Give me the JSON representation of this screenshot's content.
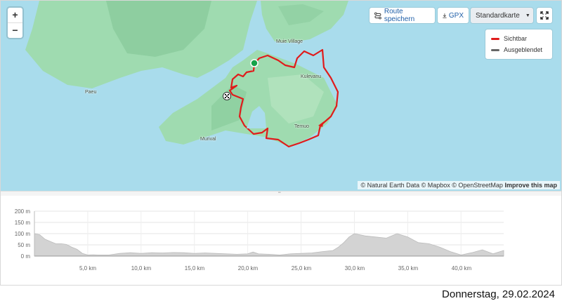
{
  "map": {
    "zoom_in": "+",
    "zoom_out": "−",
    "places": [
      "Muie Village",
      "Kulevanu",
      "Paeu",
      "Temuo",
      "Murival"
    ],
    "colors": {
      "water": "#a9dcec",
      "land": "#9fdbb0",
      "route": "#e01b1b"
    }
  },
  "toolbar": {
    "save_route": "Route speichern",
    "save_icon": "route-icon",
    "gpx": "GPX",
    "gpx_icon": "download-icon",
    "map_style": "Standardkarte",
    "fullscreen_icon": "fullscreen-icon"
  },
  "legend": {
    "items": [
      {
        "label": "Sichtbar",
        "color": "#e01b1b"
      },
      {
        "label": "Ausgeblendet",
        "color": "#666666"
      }
    ]
  },
  "attribution": {
    "text": "© Natural Earth Data © Mapbox © OpenStreetMap",
    "improve": "Improve this map"
  },
  "chart_data": {
    "type": "area",
    "y_ticks": [
      "0 m",
      "50 m",
      "100 m",
      "150 m",
      "200 m"
    ],
    "x_ticks": [
      "5,0 km",
      "10,0 km",
      "15,0 km",
      "20,0 km",
      "25,0 km",
      "30,0 km",
      "35,0 km",
      "40,0 km"
    ],
    "xlim": [
      0,
      44
    ],
    "ylim": [
      0,
      200
    ],
    "grid": true,
    "series": [
      {
        "x": [
          0,
          0.5,
          1,
          1.5,
          2,
          2.5,
          3,
          3.5,
          4,
          4.5,
          5,
          5.5,
          6,
          7,
          8,
          9,
          10,
          11,
          12,
          13,
          14,
          15,
          16,
          17,
          18,
          19,
          20,
          20.5,
          21,
          22,
          23,
          24,
          25,
          26,
          27,
          28,
          28.5,
          29,
          29.5,
          30,
          31,
          32,
          33,
          34,
          35,
          36,
          37,
          38,
          39,
          40,
          41,
          42,
          43,
          44
        ],
        "y": [
          100,
          95,
          75,
          65,
          55,
          55,
          52,
          40,
          30,
          12,
          5,
          6,
          5,
          5,
          12,
          15,
          12,
          15,
          14,
          16,
          15,
          12,
          14,
          12,
          10,
          8,
          10,
          18,
          10,
          8,
          5,
          10,
          12,
          14,
          20,
          25,
          40,
          60,
          85,
          100,
          90,
          85,
          80,
          100,
          85,
          60,
          55,
          40,
          20,
          5,
          15,
          28,
          10,
          25
        ]
      }
    ]
  },
  "footer": {
    "date": "Donnerstag, 29.02.2024"
  }
}
